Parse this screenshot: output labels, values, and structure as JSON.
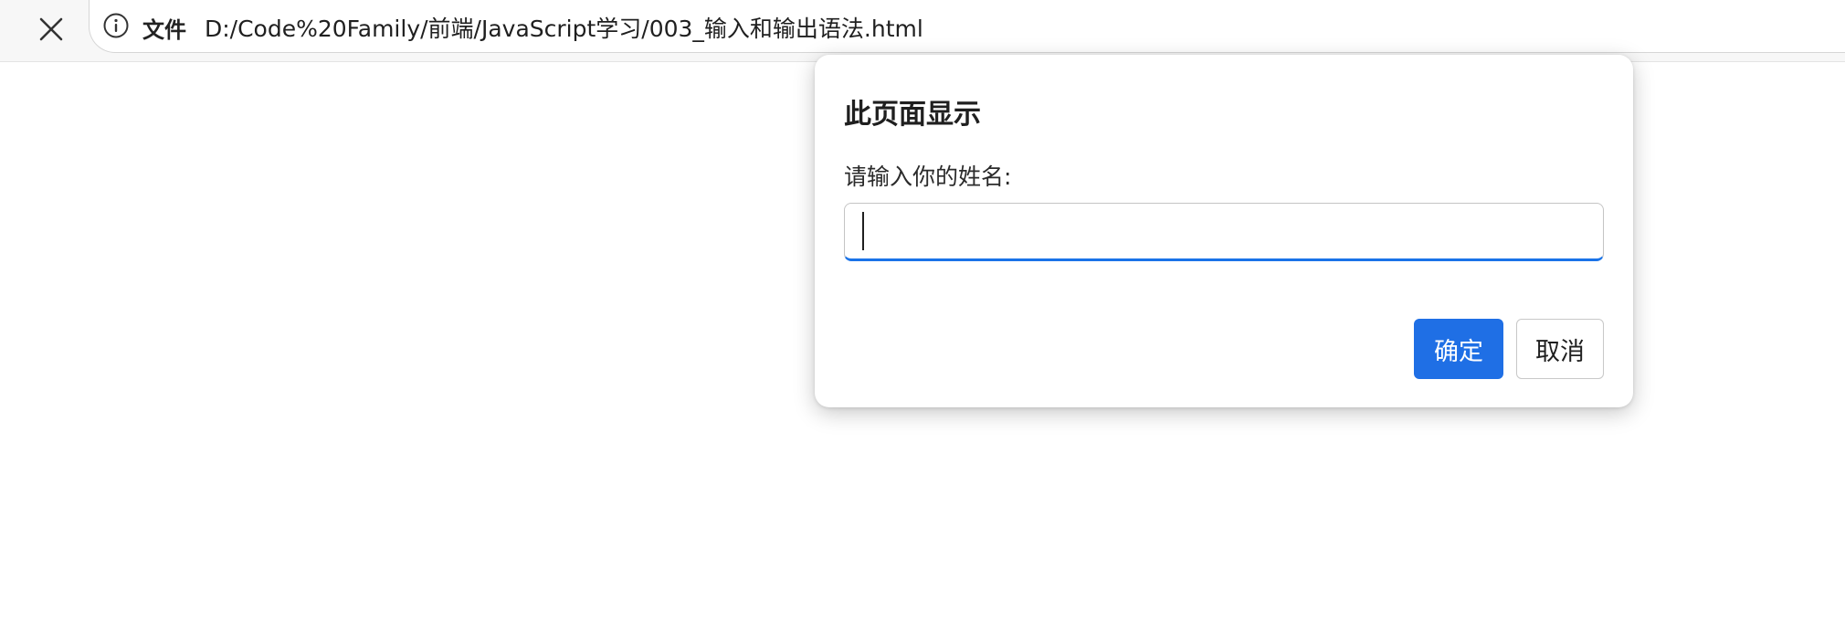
{
  "toolbar": {
    "stop_icon": "close-icon",
    "site_info_icon": "info-icon",
    "scheme_label": "文件",
    "url": "D:/Code%20Family/前端/JavaScript学习/003_输入和输出语法.html"
  },
  "dialog": {
    "title": "此页面显示",
    "message": "请输入你的姓名:",
    "input_value": "",
    "ok_label": "确定",
    "cancel_label": "取消"
  },
  "colors": {
    "accent": "#1f6fe5",
    "input_focus_border": "#1a73e8"
  }
}
